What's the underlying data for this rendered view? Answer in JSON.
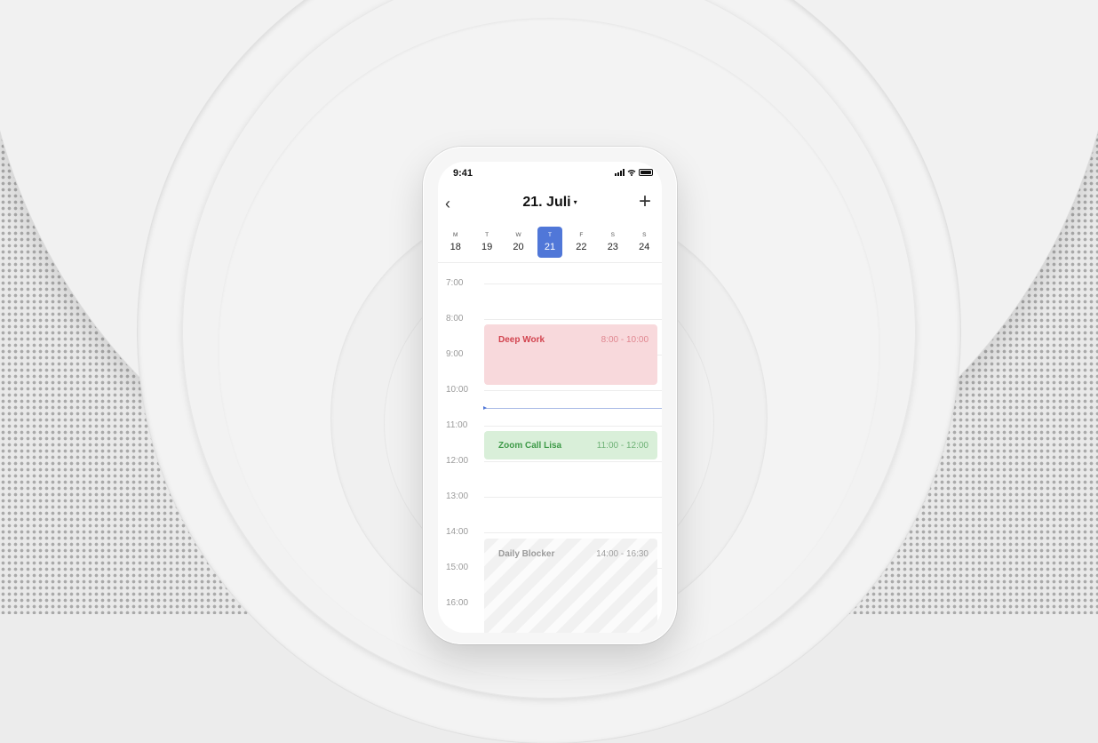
{
  "status_bar": {
    "time": "9:41"
  },
  "header": {
    "title": "21. Juli",
    "caret": "▾",
    "back_icon": "‹",
    "add_icon": "+"
  },
  "week": {
    "days": [
      {
        "letter": "M",
        "num": "18"
      },
      {
        "letter": "T",
        "num": "19"
      },
      {
        "letter": "W",
        "num": "20"
      },
      {
        "letter": "T",
        "num": "21",
        "selected": true
      },
      {
        "letter": "F",
        "num": "22"
      },
      {
        "letter": "S",
        "num": "23"
      },
      {
        "letter": "S",
        "num": "24"
      }
    ]
  },
  "hours": [
    "7:00",
    "8:00",
    "9:00",
    "10:00",
    "11:00",
    "12:00",
    "13:00",
    "14:00",
    "15:00",
    "16:00"
  ],
  "events": [
    {
      "name": "Deep Work",
      "time": "8:00 - 10:00",
      "color": "#f8d9dc"
    },
    {
      "name": "Zoom Call Lisa",
      "time": "11:00 - 12:00",
      "color": "#d9efd9"
    },
    {
      "name": "Daily Blocker",
      "time": "14:00 - 16:30",
      "color": "#f1f1f1"
    }
  ],
  "colors": {
    "accent": "#5077d8",
    "deep_work_text": "#d2444f",
    "zoom_text": "#3e9a48"
  }
}
